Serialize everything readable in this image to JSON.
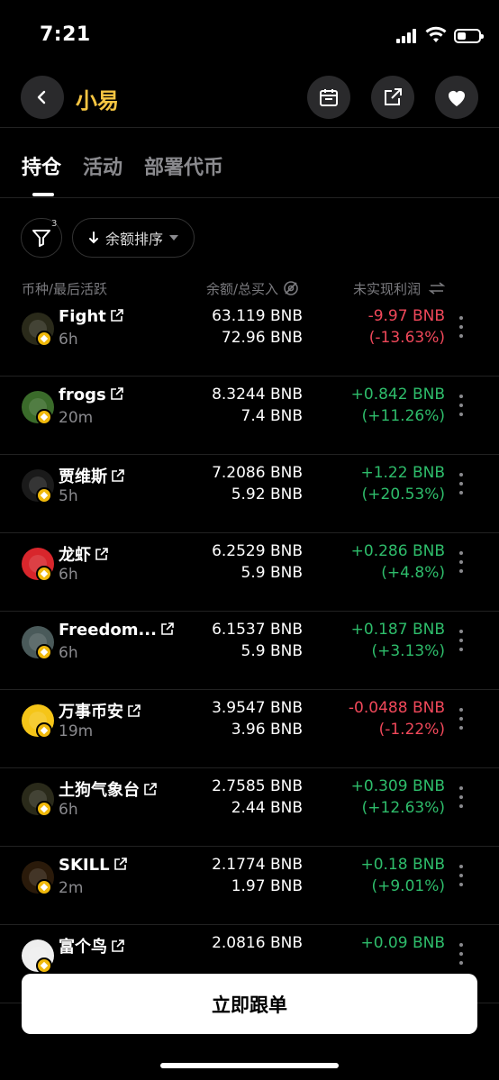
{
  "status_bar": {
    "time": "7:21"
  },
  "header": {
    "title": "小易"
  },
  "tabs": [
    {
      "label": "持仓",
      "active": true
    },
    {
      "label": "活动",
      "active": false
    },
    {
      "label": "部署代币",
      "active": false
    }
  ],
  "filter": {
    "badge": "3",
    "sort_label": "余额排序"
  },
  "columns": {
    "coin": "币种/最后活跃",
    "balance": "余额/总买入",
    "pnl": "未实现利润"
  },
  "colors": {
    "positive": "#2ebd6b",
    "negative": "#f0485a",
    "title": "#f5c542",
    "bnb_badge": "#f0b90b"
  },
  "rows": [
    {
      "name": "Fight",
      "time": "6h",
      "balance": "63.119 BNB",
      "bought": "72.96 BNB",
      "pnl": "-9.97 BNB",
      "pnl_pct": "(-13.63%)",
      "trend": "neg",
      "avatar_color": "#2a2a1a",
      "avatar_text": "FIGHT"
    },
    {
      "name": "frogs",
      "time": "20m",
      "balance": "8.3244 BNB",
      "bought": "7.4 BNB",
      "pnl": "+0.842 BNB",
      "pnl_pct": "(+11.26%)",
      "trend": "pos",
      "avatar_color": "#3a6b2a",
      "avatar_text": ""
    },
    {
      "name": "贾维斯",
      "time": "5h",
      "balance": "7.2086 BNB",
      "bought": "5.92 BNB",
      "pnl": "+1.22 BNB",
      "pnl_pct": "(+20.53%)",
      "trend": "pos",
      "avatar_color": "#1a1a1a",
      "avatar_text": ""
    },
    {
      "name": "龙虾",
      "time": "6h",
      "balance": "6.2529 BNB",
      "bought": "5.9 BNB",
      "pnl": "+0.286 BNB",
      "pnl_pct": "(+4.8%)",
      "trend": "pos",
      "avatar_color": "#d8262c",
      "avatar_text": ""
    },
    {
      "name": "Freedom...",
      "time": "6h",
      "balance": "6.1537 BNB",
      "bought": "5.9 BNB",
      "pnl": "+0.187 BNB",
      "pnl_pct": "(+3.13%)",
      "trend": "pos",
      "avatar_color": "#4a5a5a",
      "avatar_text": ""
    },
    {
      "name": "万事币安",
      "time": "19m",
      "balance": "3.9547 BNB",
      "bought": "3.96 BNB",
      "pnl": "-0.0488 BNB",
      "pnl_pct": "(-1.22%)",
      "trend": "neg",
      "avatar_color": "#f5c518",
      "avatar_text": ""
    },
    {
      "name": "土狗气象台",
      "time": "6h",
      "balance": "2.7585 BNB",
      "bought": "2.44 BNB",
      "pnl": "+0.309 BNB",
      "pnl_pct": "(+12.63%)",
      "trend": "pos",
      "avatar_color": "#2a2a1a",
      "avatar_text": ""
    },
    {
      "name": "SKILL",
      "time": "2m",
      "balance": "2.1774 BNB",
      "bought": "1.97 BNB",
      "pnl": "+0.18 BNB",
      "pnl_pct": "(+9.01%)",
      "trend": "pos",
      "avatar_color": "#2a1a0a",
      "avatar_text": ""
    },
    {
      "name": "富个鸟",
      "time": "",
      "balance": "2.0816 BNB",
      "bought": "",
      "pnl": "+0.09 BNB",
      "pnl_pct": "",
      "trend": "pos",
      "avatar_color": "#eeeeee",
      "avatar_text": ""
    }
  ],
  "footer": {
    "follow_label": "立即跟单"
  }
}
